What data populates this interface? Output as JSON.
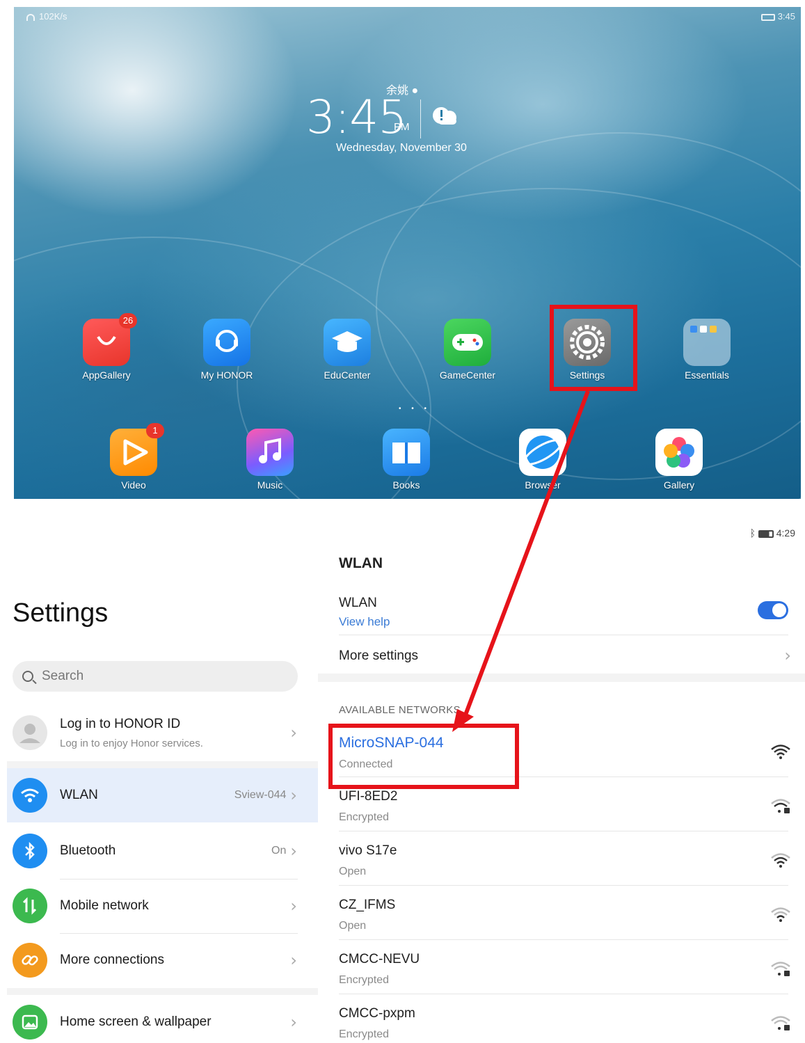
{
  "home": {
    "status": {
      "speed": "102K/s",
      "time": "3:45"
    },
    "lock": {
      "city": "余姚",
      "time": "3:45",
      "ampm": "PM",
      "date": "Wednesday, November 30"
    },
    "apps_row1": [
      {
        "label": "AppGallery",
        "icon": "appgallery-icon",
        "badge": "26"
      },
      {
        "label": "My HONOR",
        "icon": "my-honor-icon",
        "badge": ""
      },
      {
        "label": "EduCenter",
        "icon": "educenter-icon",
        "badge": ""
      },
      {
        "label": "GameCenter",
        "icon": "gamecenter-icon",
        "badge": ""
      },
      {
        "label": "Settings",
        "icon": "settings-gear-icon",
        "badge": ""
      },
      {
        "label": "Essentials",
        "icon": "essentials-folder-icon",
        "badge": ""
      }
    ],
    "apps_row2": [
      {
        "label": "Video",
        "icon": "video-icon",
        "badge": "1"
      },
      {
        "label": "Music",
        "icon": "music-icon",
        "badge": ""
      },
      {
        "label": "Books",
        "icon": "books-icon",
        "badge": ""
      },
      {
        "label": "Browser",
        "icon": "browser-icon",
        "badge": ""
      },
      {
        "label": "Gallery",
        "icon": "gallery-icon",
        "badge": ""
      }
    ]
  },
  "settings": {
    "status": {
      "time": "4:29"
    },
    "title": "Settings",
    "search_placeholder": "Search",
    "account": {
      "title": "Log in to HONOR ID",
      "subtitle": "Log in to enjoy Honor services."
    },
    "items": [
      {
        "label": "WLAN",
        "value": "Sview-044",
        "icon": "wifi-icon",
        "color": "#1f8ef1"
      },
      {
        "label": "Bluetooth",
        "value": "On",
        "icon": "bluetooth-icon",
        "color": "#1f8ef1"
      },
      {
        "label": "Mobile network",
        "value": "",
        "icon": "mobile-network-icon",
        "color": "#3cb94f"
      },
      {
        "label": "More connections",
        "value": "",
        "icon": "link-icon",
        "color": "#f39a1e"
      },
      {
        "label": "Home screen & wallpaper",
        "value": "",
        "icon": "picture-icon",
        "color": "#3cb94f"
      }
    ]
  },
  "wlan": {
    "title": "WLAN",
    "toggle_label": "WLAN",
    "view_help": "View help",
    "toggle_on": true,
    "more_settings": "More settings",
    "available_header": "AVAILABLE NETWORKS",
    "networks": [
      {
        "name": "MicroSNAP-044",
        "status": "Connected",
        "locked": false
      },
      {
        "name": "UFI-8ED2",
        "status": "Encrypted",
        "locked": true
      },
      {
        "name": "vivo S17e",
        "status": "Open",
        "locked": false
      },
      {
        "name": "CZ_IFMS",
        "status": "Open",
        "locked": false
      },
      {
        "name": "CMCC-NEVU",
        "status": "Encrypted",
        "locked": true
      },
      {
        "name": "CMCC-pxpm",
        "status": "Encrypted",
        "locked": true
      }
    ]
  },
  "colors": {
    "highlight": "#e6131a",
    "accent": "#2b6fe0",
    "link": "#3a7bd5"
  }
}
